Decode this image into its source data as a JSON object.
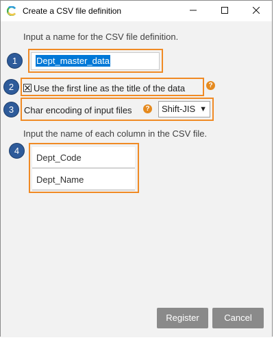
{
  "window": {
    "title": "Create a CSV file definition",
    "app_icon": "app-logo-icon",
    "minimize_icon": "minimize-icon",
    "maximize_icon": "maximize-icon",
    "close_icon": "close-icon"
  },
  "form": {
    "name_instruction": "Input a name for the CSV file definition.",
    "name_value": "Dept_master_data",
    "first_line_title_label": "Use the first line as the title of the data",
    "first_line_title_checked": true,
    "encoding_label": "Char encoding of input files",
    "encoding_value": "Shift-JIS",
    "columns_instruction": "Input the name of each column in the CSV file.",
    "columns": [
      {
        "name": "Dept_Code"
      },
      {
        "name": "Dept_Name"
      }
    ]
  },
  "callouts": [
    "1",
    "2",
    "3",
    "4"
  ],
  "buttons": {
    "register": "Register",
    "cancel": "Cancel"
  },
  "colors": {
    "callout_border": "#f08a24",
    "callout_badge": "#2e5b9a",
    "help_icon": "#e58a1f",
    "selection": "#0078d7",
    "button": "#8a8a8a"
  }
}
